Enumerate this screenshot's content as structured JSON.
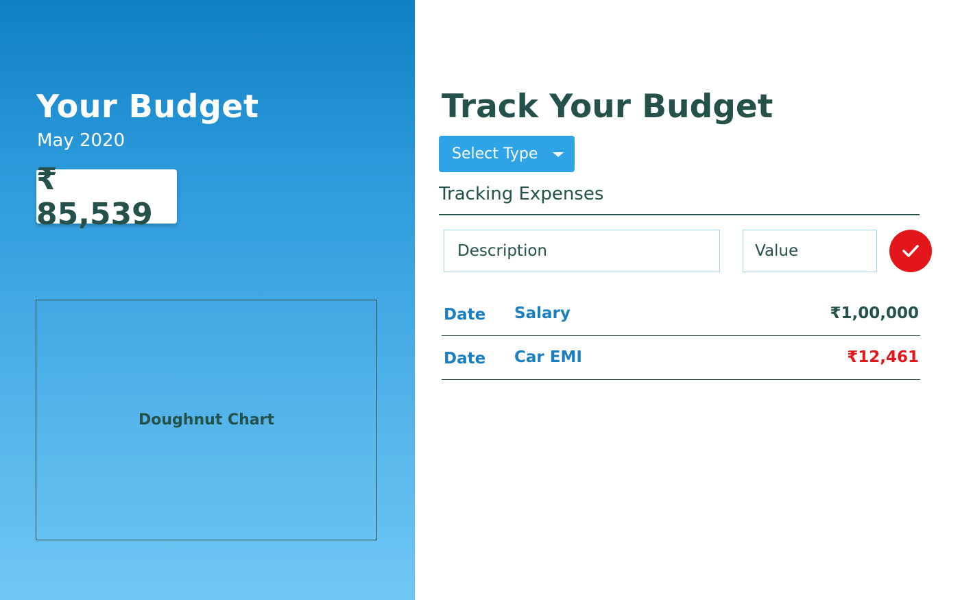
{
  "left": {
    "title": "Your Budget",
    "date": "May 2020",
    "balance": "₹ 85,539",
    "chart_placeholder": "Doughnut Chart"
  },
  "right": {
    "title": "Track Your Budget",
    "select": {
      "label": "Select Type"
    },
    "section_heading": "Tracking Expenses",
    "form": {
      "description_placeholder": "Description",
      "value_placeholder": "Value"
    },
    "entries": [
      {
        "date": "Date",
        "description": "Salary",
        "amount": "₹1,00,000",
        "type": "income"
      },
      {
        "date": "Date",
        "description": "Car EMI",
        "amount": "₹12,461",
        "type": "expense"
      }
    ]
  },
  "colors": {
    "income": "#24524a",
    "expense": "#e2161b",
    "accent": "#2ea3e6"
  }
}
